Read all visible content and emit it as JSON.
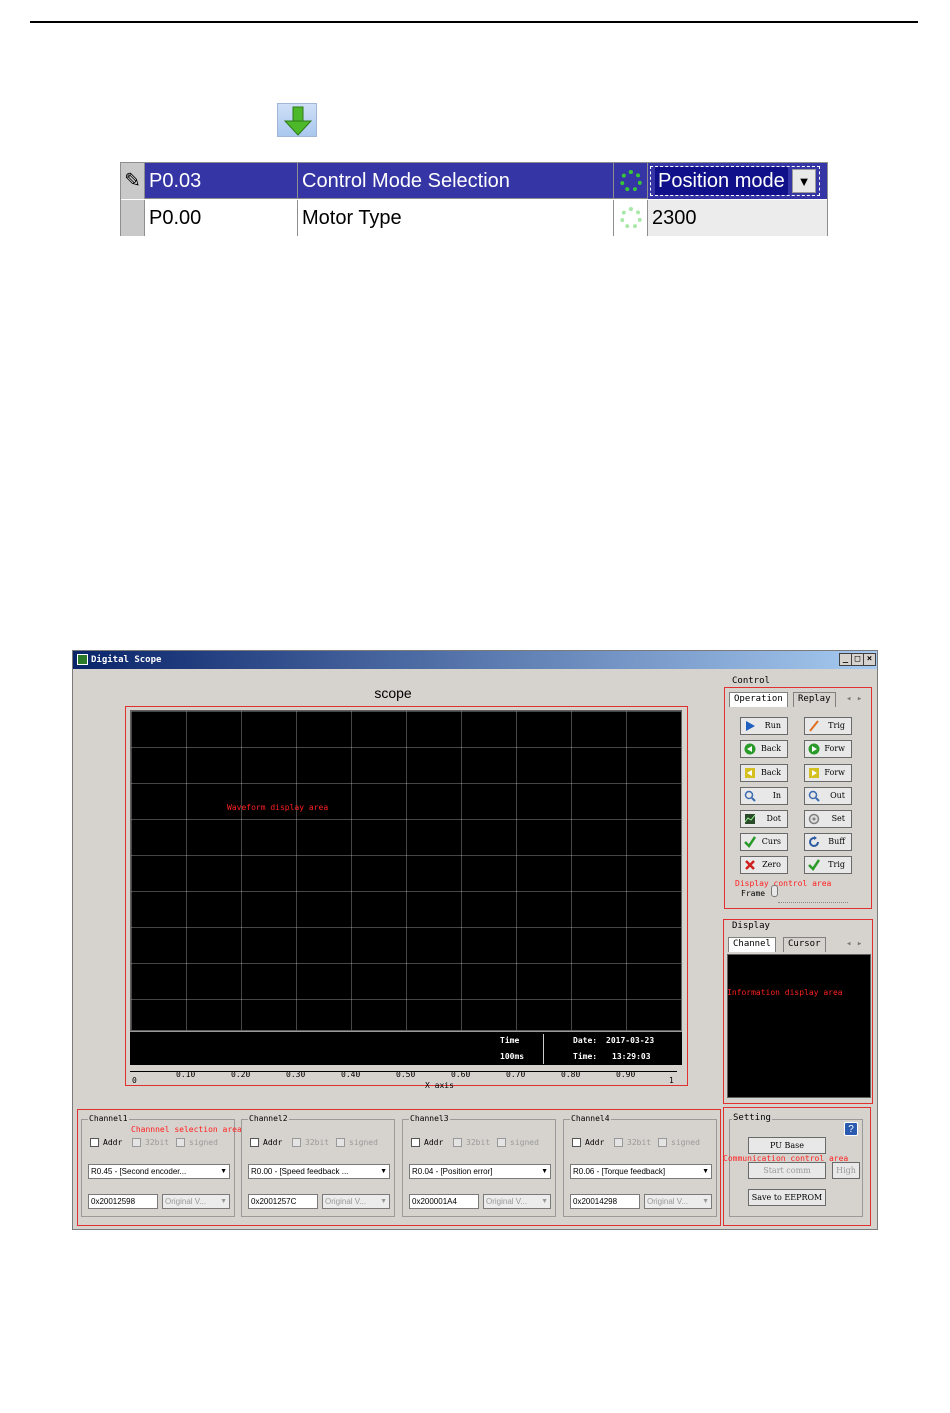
{
  "table": {
    "rows": [
      {
        "mark": "✎",
        "code": "P0.03",
        "name": "Control Mode Selection",
        "value": "Position mode",
        "selected": true
      },
      {
        "mark": "",
        "code": "P0.00",
        "name": "Motor Type",
        "value": "2300",
        "selected": false
      }
    ]
  },
  "scope": {
    "window_title": "Digital Scope",
    "scope_title": "scope",
    "waveform_label": "Waveform display area",
    "time_label": "Time",
    "time_value": "100ms",
    "date_label": "Date:",
    "date_value": "2017-03-23",
    "clock_label": "Time:",
    "clock_value": "13:29:03",
    "x_ticks": [
      "0",
      "0.10",
      "0.20",
      "0.30",
      "0.40",
      "0.50",
      "0.60",
      "0.70",
      "0.80",
      "0.90",
      "1"
    ],
    "x_axis_label": "X axis",
    "control": {
      "group_label": "Control",
      "tabs": [
        "Operation",
        "Replay"
      ],
      "buttons": [
        {
          "label": "Run",
          "icon": "play-icon",
          "color": "#1f5fbf"
        },
        {
          "label": "Trig",
          "icon": "trigger-icon",
          "color": "#e07020"
        },
        {
          "label": "Back",
          "icon": "back-icon",
          "color": "#2a9a2a"
        },
        {
          "label": "Forw",
          "icon": "forward-icon",
          "color": "#2a9a2a"
        },
        {
          "label": "Back",
          "icon": "step-back-icon",
          "color": "#d4c020"
        },
        {
          "label": "Forw",
          "icon": "step-forward-icon",
          "color": "#d4c020"
        },
        {
          "label": "In",
          "icon": "zoom-in-icon",
          "color": "#3a6ab0"
        },
        {
          "label": "Out",
          "icon": "zoom-out-icon",
          "color": "#3a6ab0"
        },
        {
          "label": "Dot",
          "icon": "dot-icon",
          "color": "#3a7a3a"
        },
        {
          "label": "Set",
          "icon": "settings-icon",
          "color": "#808080"
        },
        {
          "label": "Curs",
          "icon": "check-icon",
          "color": "#2a9a2a"
        },
        {
          "label": "Buff",
          "icon": "refresh-icon",
          "color": "#2a5aa0"
        },
        {
          "label": "Zero",
          "icon": "close-icon",
          "color": "#d02020"
        },
        {
          "label": "Trig",
          "icon": "check-icon",
          "color": "#2a9a2a"
        }
      ],
      "area_label": "Display control area",
      "frame_label": "Frame"
    },
    "display": {
      "group_label": "Display",
      "tabs": [
        "Channel",
        "Cursor"
      ],
      "area_label": "Information display area"
    },
    "channels": [
      {
        "label": "Channel1",
        "addr": "Addr",
        "bit": "32bit",
        "signed": "signed",
        "source": "R0.45 - [Second encoder...",
        "address": "0x20012598",
        "format": "Original V..."
      },
      {
        "label": "Channel2",
        "addr": "Addr",
        "bit": "32bit",
        "signed": "signed",
        "source": "R0.00 - [Speed feedback ...",
        "address": "0x2001257C",
        "format": "Original V..."
      },
      {
        "label": "Channel3",
        "addr": "Addr",
        "bit": "32bit",
        "signed": "signed",
        "source": "R0.04 - [Position error]",
        "address": "0x200001A4",
        "format": "Original V..."
      },
      {
        "label": "Channel4",
        "addr": "Addr",
        "bit": "32bit",
        "signed": "signed",
        "source": "R0.06 - [Torque feedback]",
        "address": "0x20014298",
        "format": "Original V..."
      }
    ],
    "channel_area_label": "Channnel selection area",
    "setting": {
      "group_label": "Setting",
      "pu_base": "PU Base",
      "start_comm": "Start comm",
      "high": "High",
      "save": "Save to EEPROM",
      "area_label": "Communication control area"
    }
  }
}
